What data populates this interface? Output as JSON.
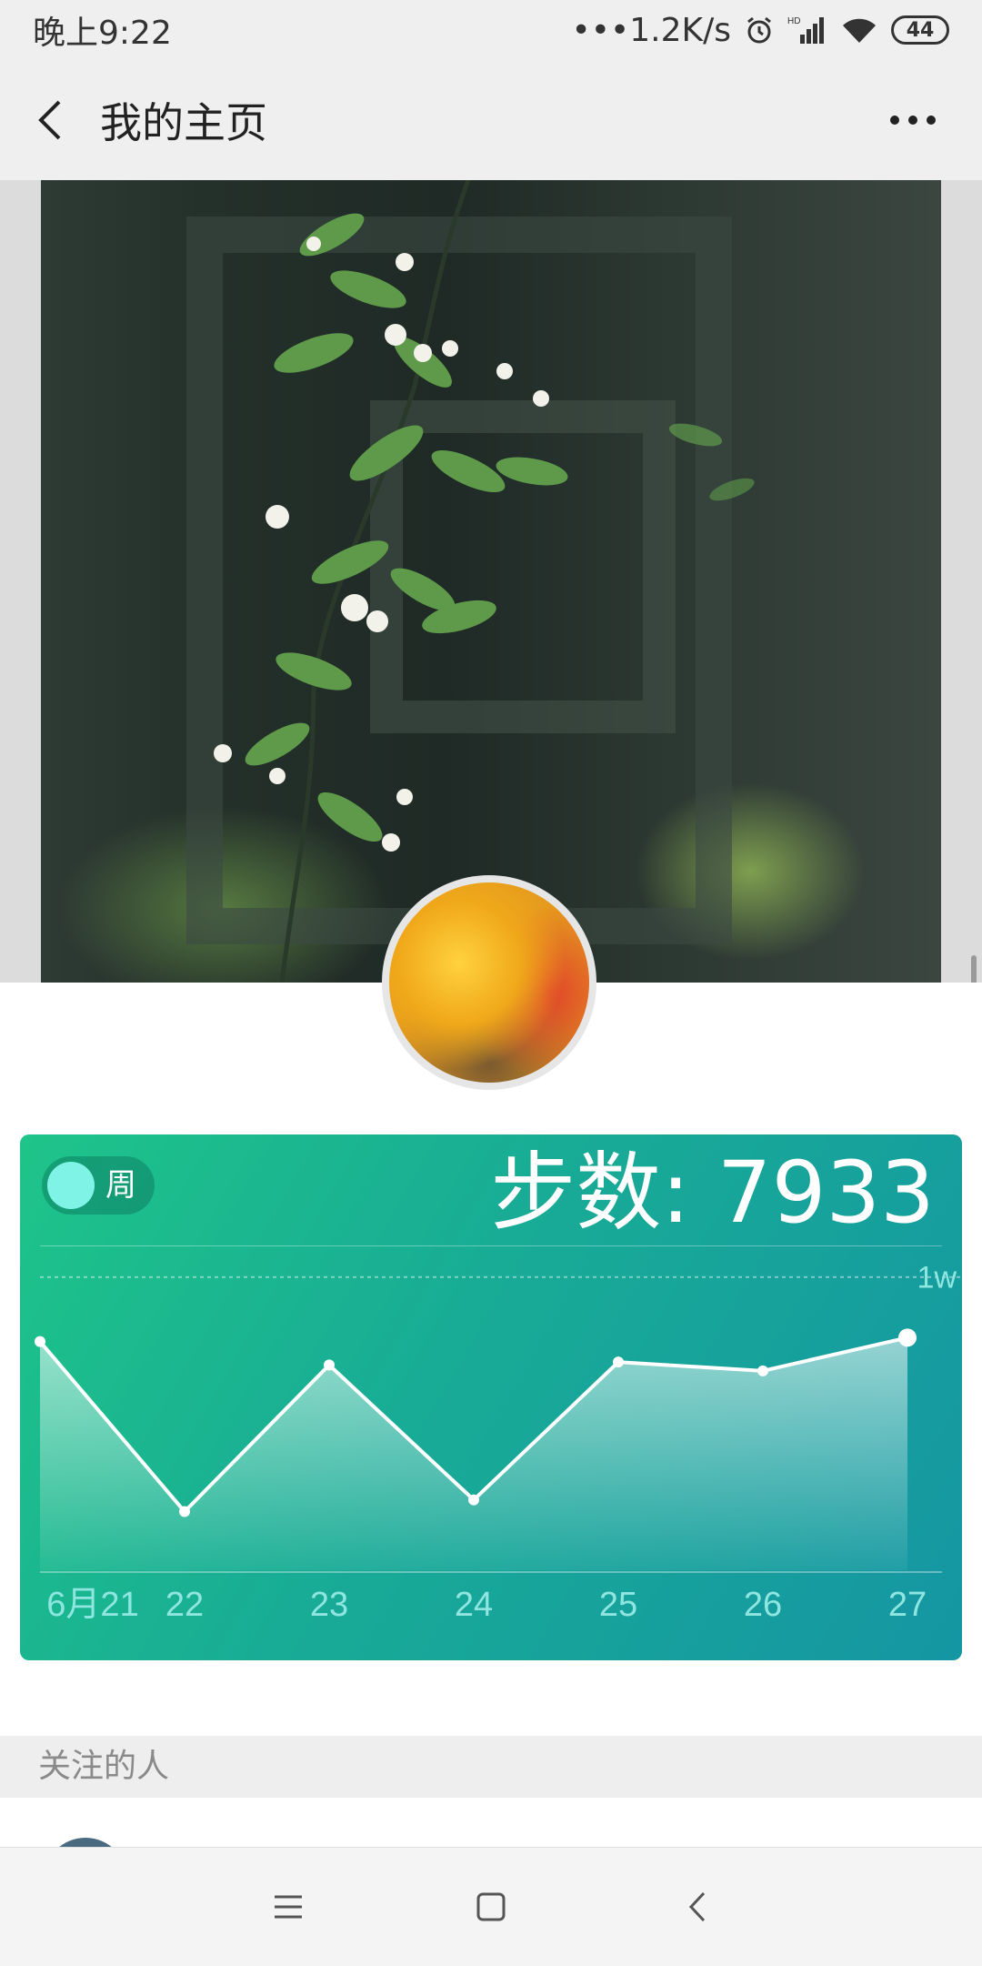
{
  "status_bar": {
    "time": "晚上9:22",
    "network_speed": "•••1.2K/s",
    "battery": "44"
  },
  "header": {
    "title": "我的主页"
  },
  "step_card": {
    "period_label": "周",
    "steps_label": "步数: 7933"
  },
  "chart_data": {
    "type": "area",
    "categories": [
      "6月21",
      "22",
      "23",
      "24",
      "25",
      "26",
      "27"
    ],
    "values": [
      7800,
      2000,
      7000,
      2400,
      7100,
      6800,
      7933
    ],
    "reference_line": {
      "label": "1w",
      "value": 10000
    },
    "ylim": [
      0,
      13000
    ],
    "grid": false,
    "colors": {
      "line": "#ffffff",
      "fill_top": "rgba(255,255,255,0.55)",
      "fill_bottom": "rgba(255,255,255,0.05)",
      "label": "#8fe6e0"
    }
  },
  "following": {
    "section_title": "关注的人"
  },
  "icons": {
    "back": "back-arrow-icon",
    "more": "more-dots-icon",
    "nav_menu": "menu-icon",
    "nav_home": "home-square-icon",
    "nav_back": "back-chevron-icon"
  }
}
